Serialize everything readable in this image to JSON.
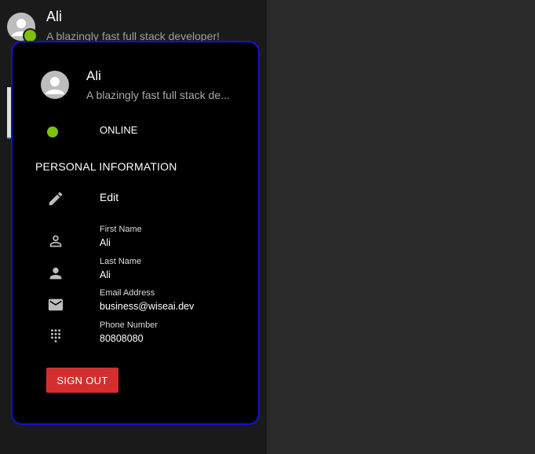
{
  "header": {
    "user_name": "Ali",
    "user_bio": "A blazingly fast full stack developer!",
    "status_color": "#7cc10b"
  },
  "profile_card": {
    "name": "Ali",
    "bio": "A blazingly fast full stack de...",
    "status": "ONLINE",
    "border_color": "#1212e0",
    "section_title": "PERSONAL INFORMATION",
    "edit_label": "Edit",
    "fields": [
      {
        "label": "First Name",
        "value": "Ali",
        "icon": "person-outline-icon"
      },
      {
        "label": "Last Name",
        "value": "Ali",
        "icon": "person-icon"
      },
      {
        "label": "Email Address",
        "value": "business@wiseai.dev",
        "icon": "email-icon"
      },
      {
        "label": "Phone Number",
        "value": "80808080",
        "icon": "dialpad-icon"
      }
    ],
    "sign_out_label": "SIGN OUT",
    "sign_out_color": "#d32f2f"
  }
}
